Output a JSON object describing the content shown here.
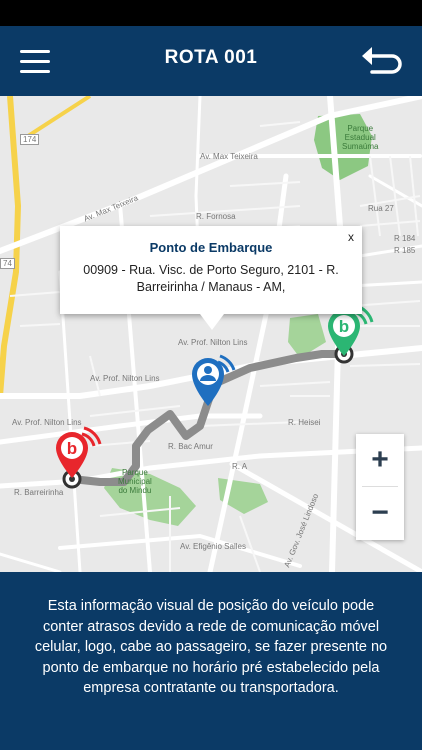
{
  "header": {
    "title": "ROTA 001",
    "menu_icon": "hamburger-menu-icon",
    "back_icon": "return-arrow-icon"
  },
  "popup": {
    "title": "Ponto de Embarque",
    "address": "00909 - Rua. Visc. de Porto Seguro, 2101 - R. Barreirinha / Manaus - AM,",
    "close_label": "x"
  },
  "map": {
    "labels": {
      "park_sumauma": "Parque\nEstadual\nSumaúma",
      "park_mindu": "Parque\nMunicipal\ndo Mindu",
      "av_max_teixeira_1": "Av. Max Teixeira",
      "av_max_teixeira_2": "Av. Max Teixeira",
      "av_nilton_lins": "Av. Prof. Nilton Lins",
      "av_nilton_lins_2": "Av. Prof. Nilton Lins",
      "av_nilton_lins_3": "Av. Prof. Nilton Lins",
      "r_heisei": "R. Heisei",
      "r_barreirinha": "R. Barreirinha",
      "r_fornosa": "R. Fornosa",
      "r_a": "R. A",
      "rua_27": "Rua 27",
      "av_gov_jose_lindoso": "Av. Gov. José Lindoso",
      "r_bac_amur": "R. Bac Amur",
      "av_efigenio_salles": "Av. Efigênio Salles",
      "r_184": "R 184",
      "r_185": "R 185",
      "r_174": "174",
      "r_74": "74"
    },
    "markers": {
      "start_icon": "brand-b-location-pin-icon",
      "bus_icon": "passenger-location-pin-icon",
      "end_icon": "brand-b-location-pin-icon"
    }
  },
  "zoom": {
    "in_label": "+",
    "out_label": "−"
  },
  "info": {
    "text": "Esta informação visual de posição do veículo pode conter atrasos devido a rede de comunicação móvel celular, logo, cabe ao passageiro, se fazer presente no ponto de embarque no horário pré estabelecido pela empresa contratante ou transportadora."
  },
  "colors": {
    "primary": "#0b3a66",
    "start_pin": "#e8262c",
    "bus_pin": "#1f6fc0",
    "end_pin": "#2bb673",
    "route": "#8c8c8c",
    "park": "#8cc882"
  }
}
